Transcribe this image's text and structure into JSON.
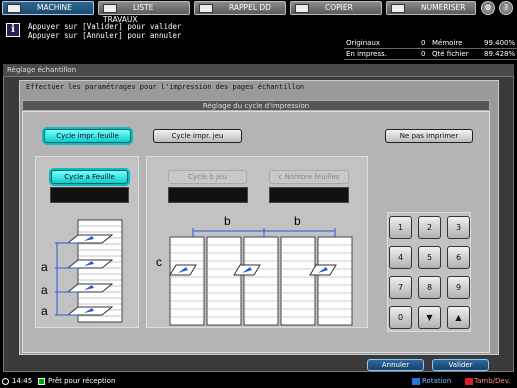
{
  "tabs": [
    {
      "label": "MACHINE",
      "icon": "machine-icon"
    },
    {
      "label": "LISTE TRAVAUX",
      "icon": "job-list-icon"
    },
    {
      "label": "RAPPEL DD",
      "icon": "hdd-recall-icon"
    },
    {
      "label": "COPIER",
      "icon": "copy-icon"
    },
    {
      "label": "NUMERISER",
      "icon": "scan-icon"
    }
  ],
  "top_buttons": {
    "gear": "⚙",
    "help": "?"
  },
  "message": {
    "icon": "i",
    "line1": "Appuyer sur [Valider] pour valider",
    "line2": "Appuyer sur [Annuler] pour annuler"
  },
  "counters": [
    {
      "label": "Originaux",
      "value": "0",
      "label2": "Mémoire",
      "value2": "99.400%"
    },
    {
      "label": "En impress.",
      "value": "0",
      "label2": "Qté fichier",
      "value2": "89.428%"
    }
  ],
  "screen_title": "Réglage échantillon",
  "instruction": "Effectuer les paramétrages pour l'impression des pages échantillon",
  "section_title": "Réglage du cycle d'impression",
  "mode_buttons": {
    "cycle_feuille": "Cycle impr. feuille",
    "cycle_jeu": "Cycle impr. jeu",
    "ne_pas": "Ne pas imprimer"
  },
  "left_panel": {
    "cycle_a": "Cycle a   Feuille"
  },
  "mid_panel": {
    "cycle_b": "Cycle b   Jeu",
    "cycle_c": "c Nombre feuilles"
  },
  "diagram_letters": {
    "a": "a",
    "b": "b",
    "c": "c"
  },
  "keypad": [
    "1",
    "2",
    "3",
    "4",
    "5",
    "6",
    "7",
    "8",
    "9",
    "0",
    "▼",
    "▲"
  ],
  "bottom": {
    "cancel": "Annuler",
    "ok": "Valider"
  },
  "status": {
    "time": "14:45",
    "text": "Prêt pour réception",
    "rotation": "Rotation",
    "tamb": "Tamb/Dev."
  }
}
